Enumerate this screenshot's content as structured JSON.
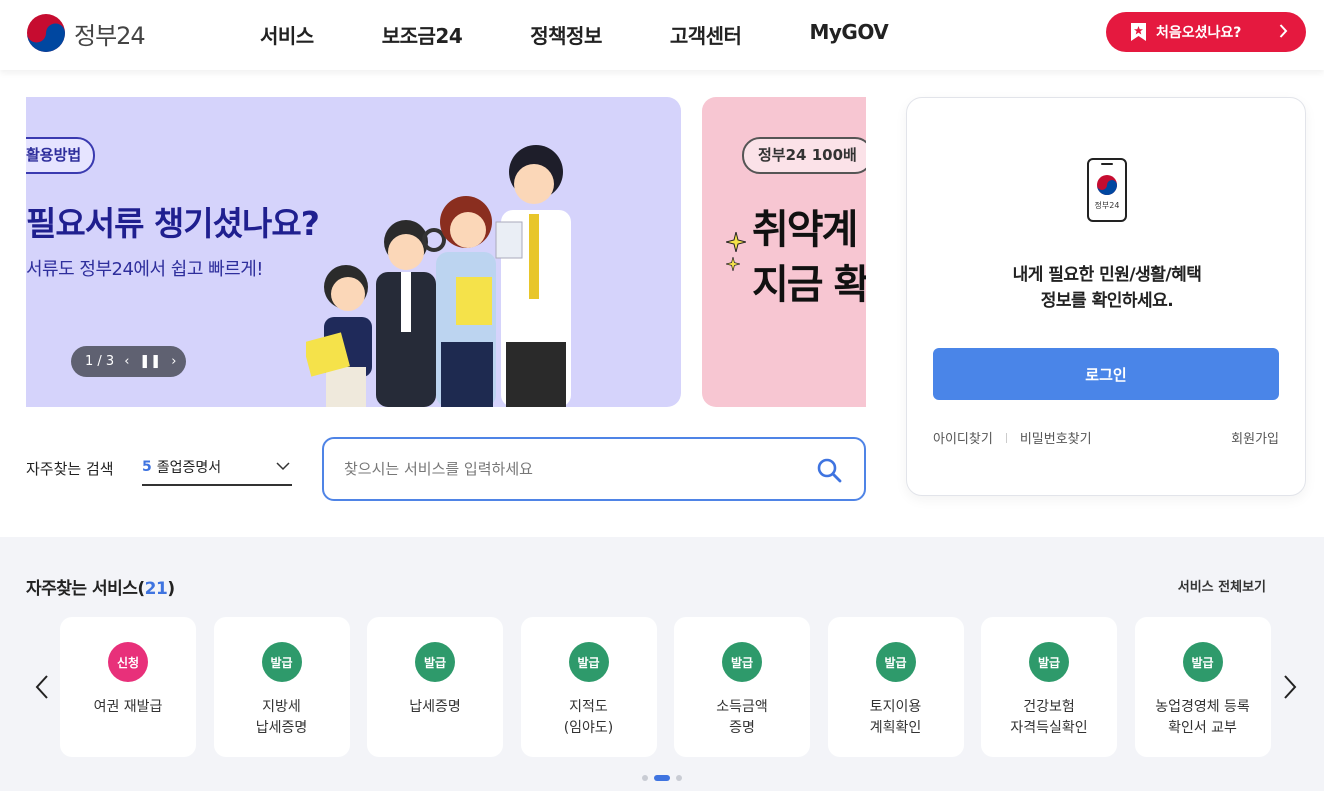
{
  "header": {
    "logo_text": "정부24",
    "nav": [
      "서비스",
      "보조금24",
      "정책정보",
      "고객센터",
      "MyGOV"
    ],
    "first_visit_label": "처음오셨나요?",
    "first_visit_color": "#e5193f"
  },
  "banner": {
    "slide1": {
      "pill": "활용방법",
      "headline": "필요서류 챙기셨나요?",
      "subline": "서류도 정부24에서 쉽고 빠르게!",
      "pager": "1 / 3",
      "background": "#d5d3fb"
    },
    "slide2": {
      "pill": "정부24 100배",
      "headline1": "취약계",
      "headline2": "지금 확",
      "background": "#f7c6d2"
    }
  },
  "search": {
    "label": "자주찾는 검색",
    "keyword_rank": "5",
    "keyword": "졸업증명서",
    "placeholder": "찾으시는 서비스를 입력하세요",
    "accent": "#4f84e6"
  },
  "login": {
    "app_label": "정부24",
    "message_line1": "내게 필요한 민원/생활/혜택",
    "message_line2": "정보를 확인하세요.",
    "login_button": "로그인",
    "find_id": "아이디찾기",
    "find_password": "비밀번호찾기",
    "join": "회원가입",
    "button_color": "#4a85e8"
  },
  "services": {
    "title": "자주찾는 서비스(",
    "count": "21",
    "title_end": ")",
    "view_all": "서비스 전체보기",
    "items": [
      {
        "badge": "신청",
        "badge_color": "#e8307a",
        "label": "여권 재발급"
      },
      {
        "badge": "발급",
        "badge_color": "#2e9a6b",
        "label": "지방세\n납세증명"
      },
      {
        "badge": "발급",
        "badge_color": "#2e9a6b",
        "label": "납세증명"
      },
      {
        "badge": "발급",
        "badge_color": "#2e9a6b",
        "label": "지적도\n(임야도)"
      },
      {
        "badge": "발급",
        "badge_color": "#2e9a6b",
        "label": "소득금액\n증명"
      },
      {
        "badge": "발급",
        "badge_color": "#2e9a6b",
        "label": "토지이용\n계획확인"
      },
      {
        "badge": "발급",
        "badge_color": "#2e9a6b",
        "label": "건강보험\n자격득실확인"
      },
      {
        "badge": "발급",
        "badge_color": "#2e9a6b",
        "label": "농업경영체 등록\n확인서 교부"
      }
    ]
  }
}
